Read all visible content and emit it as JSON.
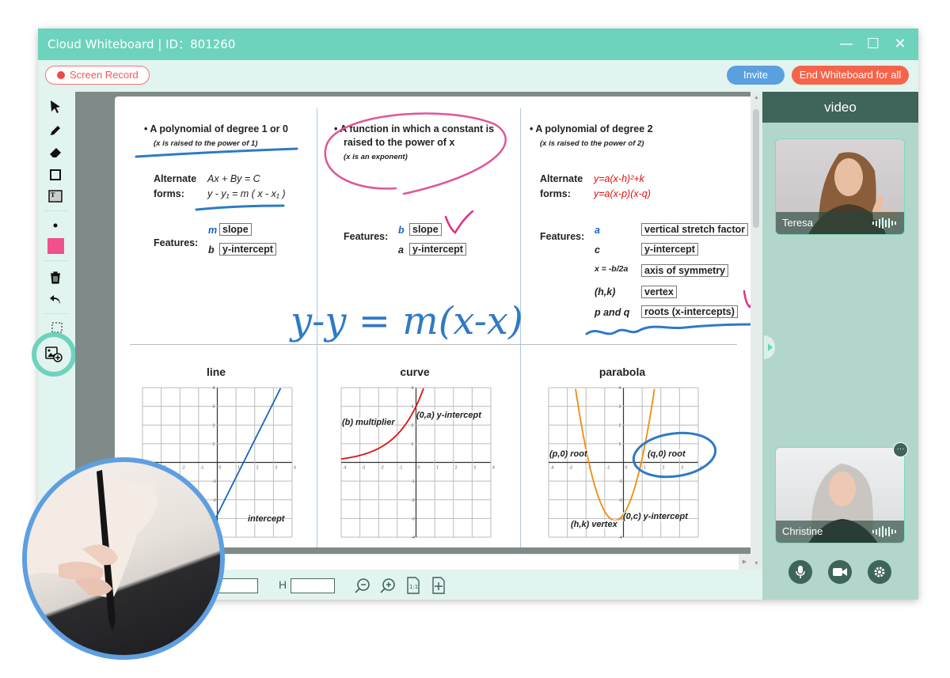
{
  "window": {
    "title": "Cloud Whiteboard  |  ID：801260",
    "minimize": "—",
    "maximize": "☐",
    "close": "✕"
  },
  "toolbar": {
    "screen_record": "Screen Record",
    "invite": "Invite",
    "end_whiteboard": "End Whiteboard for all"
  },
  "tools": [
    "select",
    "pen",
    "eraser",
    "rectangle",
    "text",
    "dot-size",
    "color",
    "delete",
    "undo",
    "screenshot",
    "insert-image"
  ],
  "pen_color": "#f0508c",
  "board": {
    "col1": {
      "heading": "A polynomial of degree 1 or 0",
      "note": "(x is raised to the power of 1)",
      "alt_label1": "Alternate",
      "alt_label2": "forms:",
      "form1": "Ax + By = C",
      "form2": "y - y₁ = m ( x - x₁ )",
      "features": "Features:",
      "f1_sym": "m",
      "f1": "slope",
      "f2_sym": "b",
      "f2": "y-intercept"
    },
    "col2": {
      "heading1": "A function in which a constant is",
      "heading2": "raised to the power of  x",
      "note": "(x is an exponent)",
      "features": "Features:",
      "f1_sym": "b",
      "f1": "slope",
      "f2_sym": "a",
      "f2": "y-intercept"
    },
    "col3": {
      "heading": "A polynomial of degree 2",
      "note": "(x is raised to the power of 2)",
      "alt_label1": "Alternate",
      "alt_label2": "forms:",
      "form1": "y=a(x-h)²+k",
      "form2": "y=a(x-p)(x-q)",
      "features": "Features:",
      "rows": [
        {
          "sym": "a",
          "label": "vertical stretch factor"
        },
        {
          "sym": "c",
          "label": "y-intercept"
        },
        {
          "sym": "x = -b/2a",
          "label": "axis of symmetry"
        },
        {
          "sym": "(h,k)",
          "label": "vertex"
        },
        {
          "sym": "p and q",
          "label": "roots (x-intercepts)"
        }
      ]
    },
    "handwriting": "y-y = m(x-x)",
    "graphs": [
      {
        "title": "line",
        "labels": [
          "intercept"
        ]
      },
      {
        "title": "curve",
        "labels": [
          "(b) multiplier",
          "(0,a) y-intercept"
        ]
      },
      {
        "title": "parabola",
        "labels": [
          "(p,0) root",
          "(q,0) root",
          "(h,k) vertex",
          "(0,c) y-intercept"
        ]
      }
    ],
    "grid_range": [
      -4,
      4
    ]
  },
  "bottom": {
    "h_label": "H",
    "h_value": "",
    "zoom_out": "zoom-out-icon",
    "zoom_in": "zoom-in-icon",
    "actual_size": "1:1",
    "fit": "fit-icon"
  },
  "video": {
    "title": "video",
    "participants": [
      {
        "name": "Teresa"
      },
      {
        "name": "Christine"
      }
    ],
    "more": "···"
  }
}
